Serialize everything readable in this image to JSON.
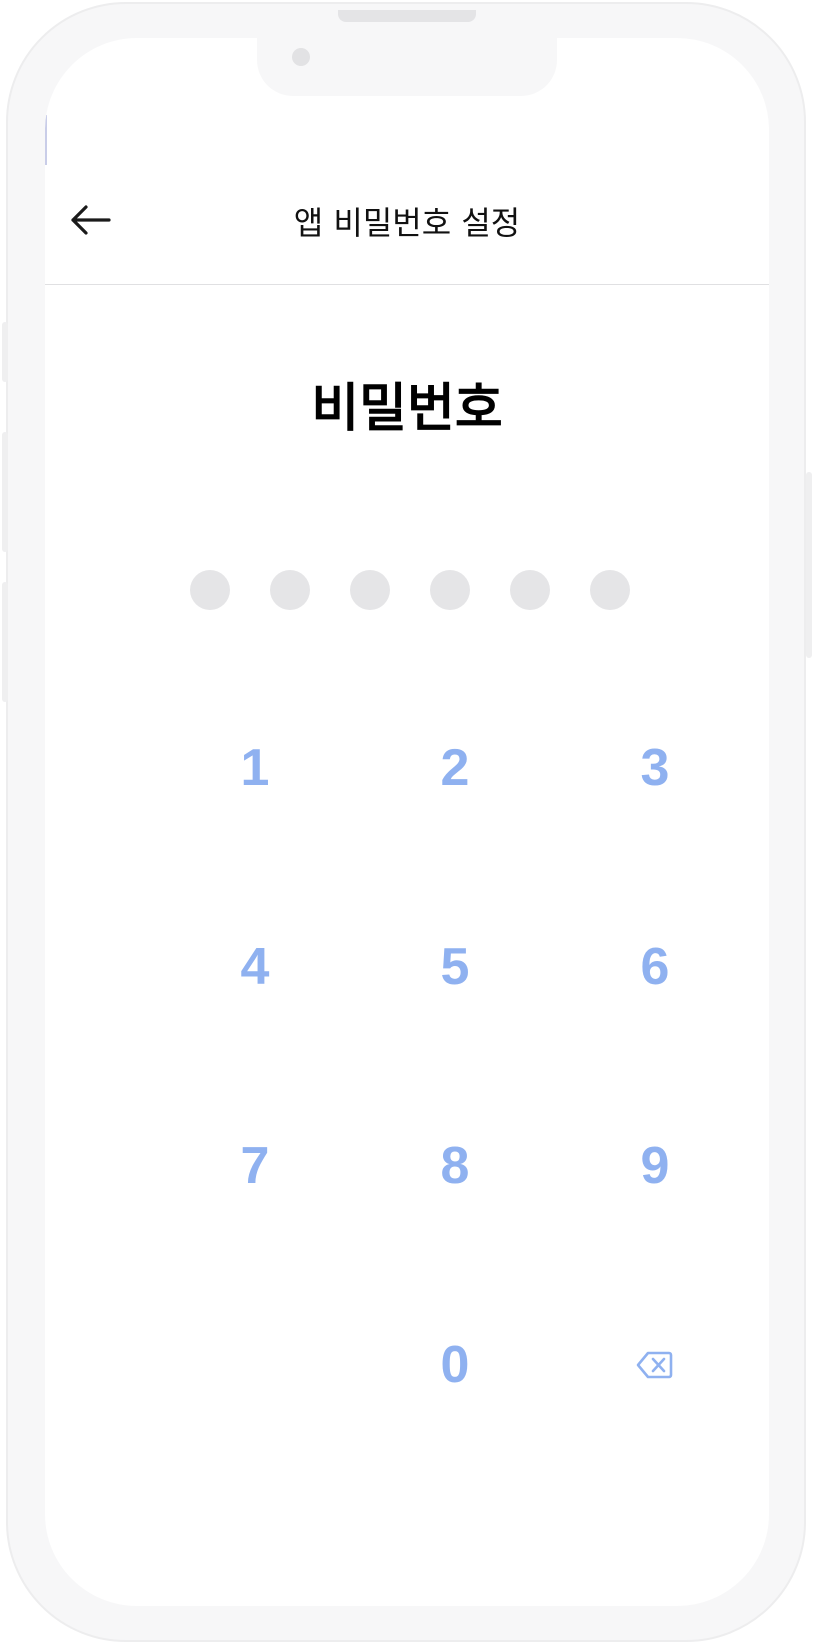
{
  "header": {
    "back_icon": "arrow-left-icon",
    "title": "앱 비밀번호 설정"
  },
  "main": {
    "heading": "비밀번호",
    "pin_length": 6,
    "pin_entered": 0
  },
  "keypad": {
    "keys": [
      "1",
      "2",
      "3",
      "4",
      "5",
      "6",
      "7",
      "8",
      "9",
      "",
      "0",
      "backspace"
    ],
    "backspace_icon": "backspace-icon"
  },
  "colors": {
    "key_text": "#8fb1f0",
    "dot_empty": "#e5e5e7",
    "divider": "#e0e0e2"
  }
}
